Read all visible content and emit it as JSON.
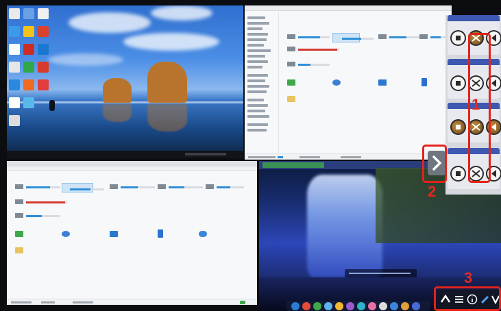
{
  "layout": {
    "mode": "quad-split"
  },
  "quadrants": {
    "top_left": {
      "type": "desktop",
      "wallpaper": "sea-arch-rocks"
    },
    "top_right": {
      "type": "file-explorer"
    },
    "bottom_left": {
      "type": "file-explorer"
    },
    "bottom_right": {
      "type": "desktop",
      "wallpaper": "waterfall"
    }
  },
  "side_panel": {
    "toggle_icon": "chevron-right-icon",
    "cards": [
      {
        "controls": [
          "stop-icon",
          "swap-icon",
          "play-back-icon"
        ]
      },
      {
        "controls": [
          "stop-icon",
          "swap-icon",
          "play-back-icon"
        ]
      },
      {
        "controls": [
          "stop-icon",
          "swap-icon",
          "play-back-icon"
        ]
      },
      {
        "controls": [
          "stop-icon",
          "swap-icon",
          "play-back-icon"
        ]
      }
    ]
  },
  "bottom_toolbar": {
    "buttons": [
      "chevron-up-icon",
      "menu-icon",
      "info-icon",
      "pen-icon",
      "more-icon"
    ]
  },
  "annotations": {
    "label_1": "1",
    "label_2": "2",
    "label_3": "3"
  },
  "colors": {
    "annotation": "#e2231a",
    "panel_header": "#3c58b0",
    "accent": "#2d8ed8"
  }
}
